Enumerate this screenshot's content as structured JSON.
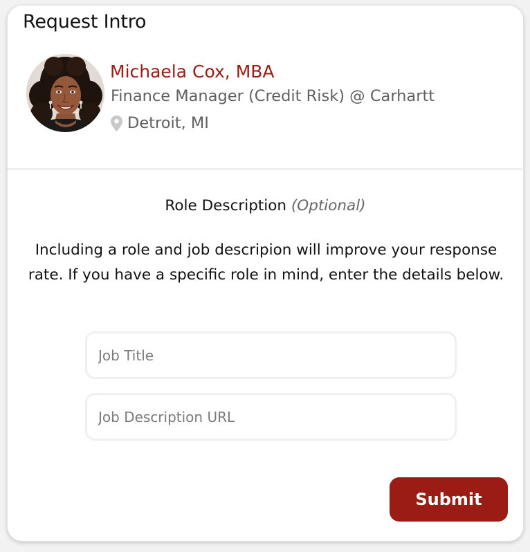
{
  "header": {
    "title": "Request Intro"
  },
  "profile": {
    "name": "Michaela Cox, MBA",
    "role": "Finance Manager (Credit Risk) @ Carhartt",
    "location": "Detroit, MI",
    "location_icon": "map-pin-icon",
    "avatar": "profile-photo"
  },
  "role_section": {
    "heading": "Role Description",
    "optional": "(Optional)",
    "description": "Including a role and job descripion will improve your response rate. If you have a specific role in mind, enter the details below."
  },
  "form": {
    "job_title_placeholder": "Job Title",
    "job_title_value": "",
    "job_url_placeholder": "Job Description URL",
    "job_url_value": "",
    "submit_label": "Submit"
  },
  "colors": {
    "accent": "#9b1c14",
    "secondary_text": "#606060",
    "divider": "#efefef"
  }
}
